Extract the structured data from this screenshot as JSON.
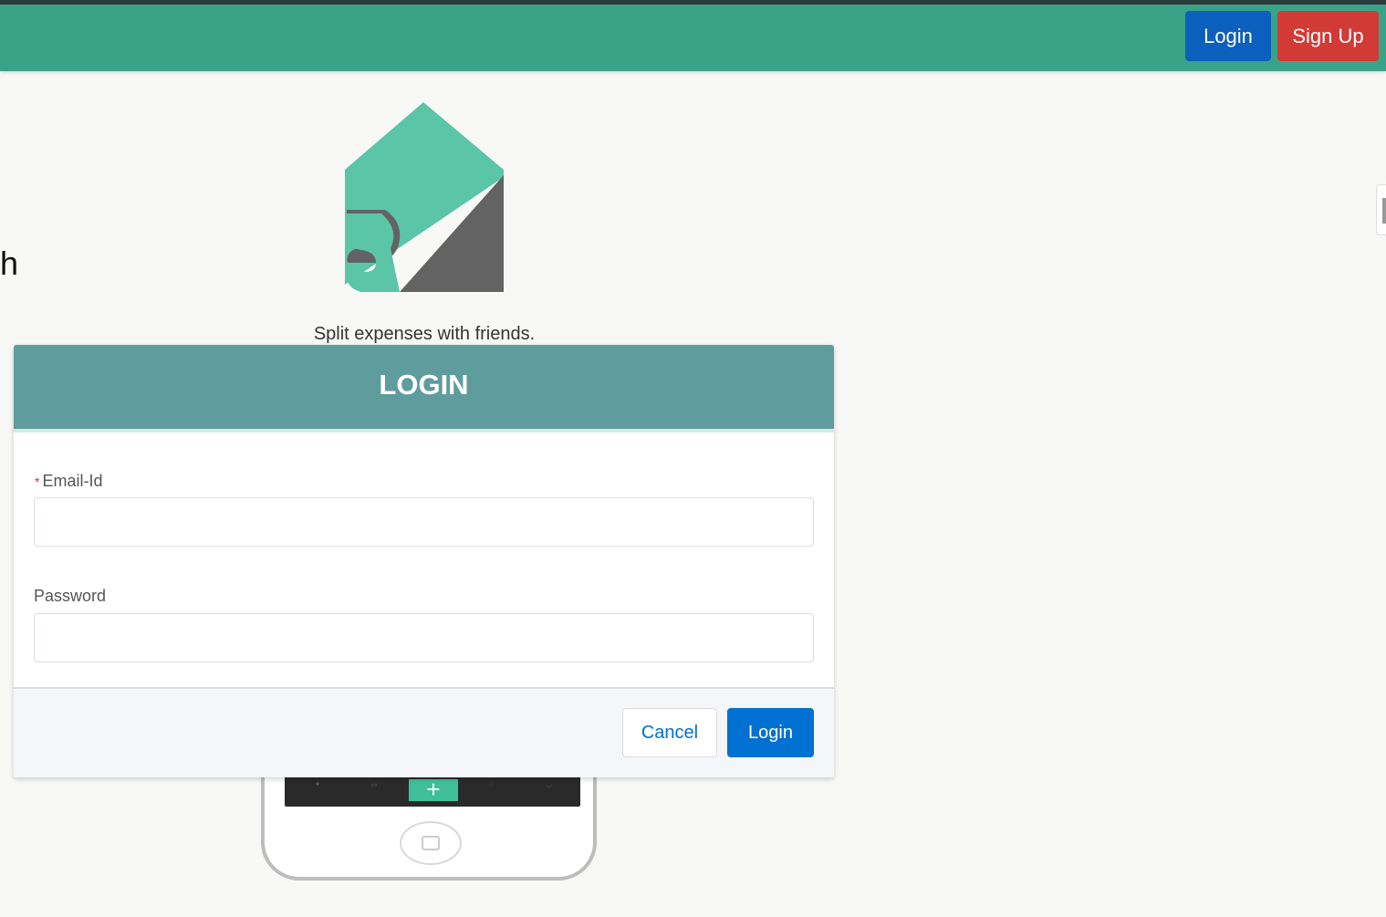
{
  "nav": {
    "login_label": "Login",
    "signup_label": "Sign Up"
  },
  "background": {
    "left_fragment": "h",
    "tagline": "Split expenses with friends."
  },
  "modal": {
    "title": "LOGIN",
    "email": {
      "required_mark": "*",
      "label": "Email-Id",
      "value": "",
      "placeholder": ""
    },
    "password": {
      "label": "Password",
      "value": "",
      "placeholder": ""
    },
    "cancel_label": "Cancel",
    "login_label": "Login"
  },
  "colors": {
    "topbar": "#3aa387",
    "nav_login": "#0b5fbd",
    "nav_signup": "#d23a36",
    "modal_header": "#5f9c9d",
    "primary_button": "#0070d2",
    "logo_green": "#5bc5a7",
    "logo_gray": "#636363"
  }
}
